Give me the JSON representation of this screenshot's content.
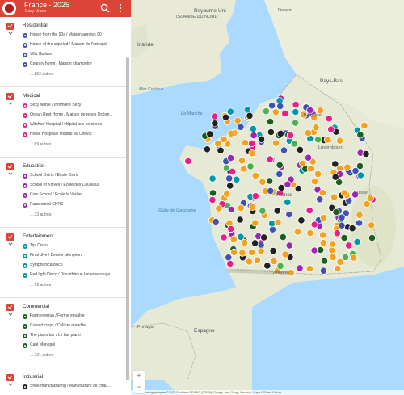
{
  "header": {
    "title": "France - 2025",
    "subtitle": "Easy Urbex",
    "brand_color": "#db4437"
  },
  "categories": [
    {
      "name": "Residential",
      "items": [
        {
          "label": "House from the 90s / Maison années 90",
          "color": "#3f51b5"
        },
        {
          "label": "House of the crippled / Maison de l'estropié",
          "color": "#3f51b5"
        },
        {
          "label": "Villa Guitare",
          "color": "#3f51b5"
        },
        {
          "label": "Country home / Maison champêtre",
          "color": "#3f51b5"
        }
      ],
      "more": "... 853 autres"
    },
    {
      "name": "Medical",
      "items": [
        {
          "label": "Sexy Nurse / Infirmière Sexy",
          "color": "#e91e8c"
        },
        {
          "label": "Ocean Rest Home / Maison de repos Océan...",
          "color": "#e91e8c"
        },
        {
          "label": "Witches' Hospital / Hôpital aux sorcières",
          "color": "#e91e8c"
        },
        {
          "label": "Horse Hospital / Hôpital du Cheval",
          "color": "#e91e8c"
        }
      ],
      "more": "... 69 autres"
    },
    {
      "name": "Education",
      "items": [
        {
          "label": "School Osiris / Ecole Osiris",
          "color": "#9c27b0"
        },
        {
          "label": "School of Knives / Ecole des Couteaux",
          "color": "#9c27b0"
        },
        {
          "label": "Cow School / Ecole la Vache",
          "color": "#9c27b0"
        },
        {
          "label": "Paranormal CNRS",
          "color": "#9c27b0"
        }
      ],
      "more": "... 33 autres"
    },
    {
      "name": "Entertainment",
      "items": [
        {
          "label": "Tipi Disco",
          "color": "#0097a7"
        },
        {
          "label": "Final dive / Dernier plongeon",
          "color": "#0097a7"
        },
        {
          "label": "Symphonica disco",
          "color": "#0097a7"
        },
        {
          "label": "Red light Disco / Discothèque lanterne rouge",
          "color": "#0097a7"
        }
      ],
      "more": "... 99 autres"
    },
    {
      "name": "Commercial",
      "items": [
        {
          "label": "Farm overrun / Ferme envahie",
          "color": "#1b5e20"
        },
        {
          "label": "Cursed crops / Culture maudite",
          "color": "#1b5e20"
        },
        {
          "label": "The piano bar / Le bar piano",
          "color": "#1b5e20"
        },
        {
          "label": "Café Monopol",
          "color": "#1b5e20"
        }
      ],
      "more": "... 221 autres"
    },
    {
      "name": "Industrial",
      "items": [
        {
          "label": "Shoe manufacturing / Manufacture de chau...",
          "color": "#212121"
        }
      ],
      "more": ""
    }
  ],
  "map": {
    "places": {
      "islande": "ISLANDE DU NORD",
      "uk": "Royaume-Uni",
      "danemark": "Danem",
      "irlande": "Irlande",
      "paysbas": "Pays-Bas",
      "belgique": "Belgique",
      "luxembourg": "Luxembourg",
      "suisse": "Suisse",
      "france": "France",
      "andorre": "Andorre",
      "portugal": "Portugal",
      "espagne": "Espagne",
      "golfe": "Golfe de Gascogne",
      "manche": "La Manche",
      "mer_celtique": "Mer Celtique"
    },
    "zoom_in": "+",
    "zoom_out": "−",
    "attribution": "Données cartographiques ©2025 GeoBasis-DE/BKG (©2009), Google, Inst. Geogr. Nacional, Mapa GISrael  100 km"
  }
}
